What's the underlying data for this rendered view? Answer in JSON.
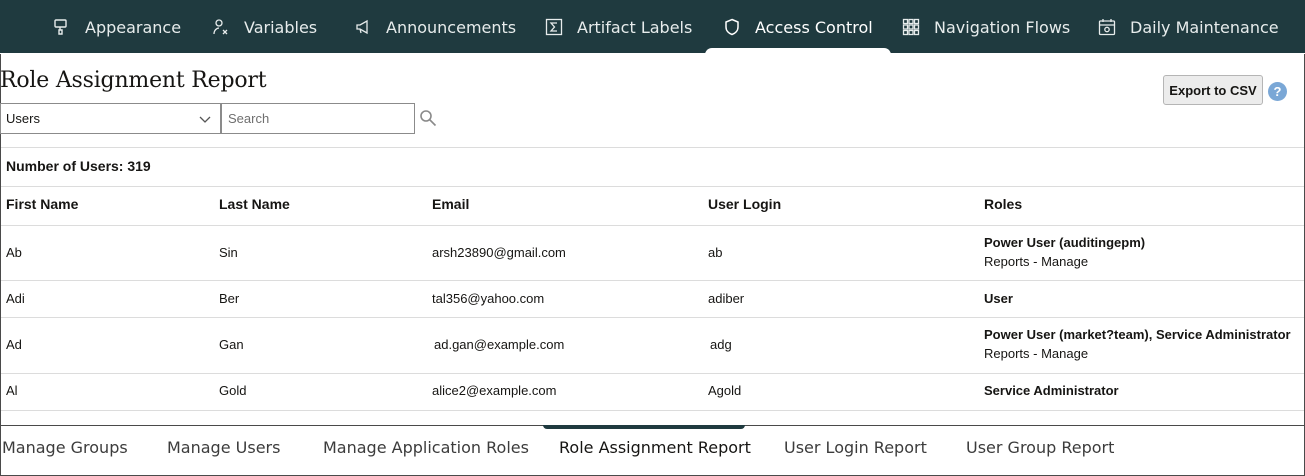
{
  "topnav": {
    "tabs": [
      {
        "label": "Appearance",
        "icon": "brush-icon"
      },
      {
        "label": "Variables",
        "icon": "variable-icon"
      },
      {
        "label": "Announcements",
        "icon": "megaphone-icon"
      },
      {
        "label": "Artifact Labels",
        "icon": "sigma-icon"
      },
      {
        "label": "Access Control",
        "icon": "shield-icon",
        "active": true
      },
      {
        "label": "Navigation Flows",
        "icon": "grid-icon"
      },
      {
        "label": "Daily Maintenance",
        "icon": "calendar-gear-icon"
      }
    ]
  },
  "page": {
    "title": "Role Assignment Report",
    "filter": {
      "selected": "Users"
    },
    "search": {
      "placeholder": "Search",
      "value": ""
    },
    "export_label": "Export to CSV",
    "help_label": "?",
    "count": {
      "label": "Number of Users:",
      "value": "319"
    }
  },
  "table": {
    "columns": [
      "First Name",
      "Last Name",
      "Email",
      "User Login",
      "Roles"
    ],
    "rows": [
      {
        "first": "Ab",
        "last": "Sin",
        "email": "arsh23890@gmail.com",
        "login": "ab",
        "roles": "Power User (auditingepm)",
        "roles_sub": "Reports - Manage"
      },
      {
        "first": "Adi",
        "last": "Ber",
        "email": "tal356@yahoo.com",
        "login": "adiber",
        "roles": "User",
        "roles_sub": ""
      },
      {
        "first": "Ad",
        "last": "Gan",
        "email": "ad.gan@example.com",
        "login": "adg",
        "roles": "Power User (market?team), Service Administrator",
        "roles_sub": "Reports - Manage"
      },
      {
        "first": "Al",
        "last": "Gold",
        "email": "alice2@example.com",
        "login": "Agold",
        "roles": "Service Administrator",
        "roles_sub": ""
      }
    ]
  },
  "bottom_tabs": [
    {
      "label": "Manage Groups"
    },
    {
      "label": "Manage Users"
    },
    {
      "label": "Manage Application Roles"
    },
    {
      "label": "Role Assignment Report",
      "active": true
    },
    {
      "label": "User Login Report"
    },
    {
      "label": "User Group Report"
    }
  ],
  "colors": {
    "nav_bg": "#1f3a3f",
    "help": "#7aa7d6"
  }
}
